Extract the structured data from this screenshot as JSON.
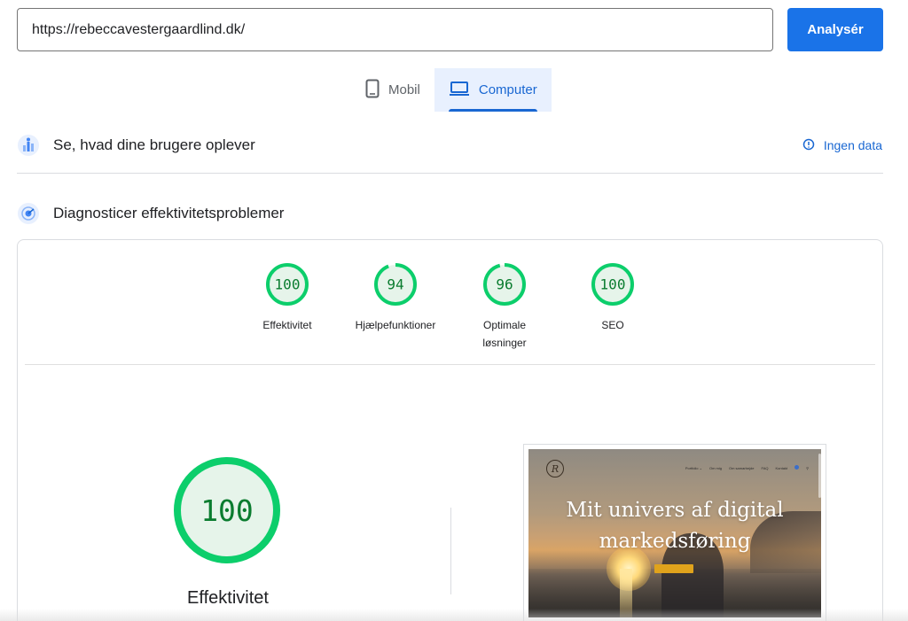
{
  "search": {
    "url_value": "https://rebeccavestergaardlind.dk/",
    "analyze_label": "Analysér"
  },
  "device_tabs": [
    {
      "label": "Mobil",
      "icon": "phone-icon",
      "active": false
    },
    {
      "label": "Computer",
      "icon": "laptop-icon",
      "active": true
    }
  ],
  "field_data": {
    "title": "Se, hvad dine brugere oplever",
    "icon": "users-chart-icon",
    "status_label": "Ingen data",
    "status_icon": "info-icon"
  },
  "lab_data": {
    "title": "Diagnosticer effektivitetsproblemer",
    "icon": "lighthouse-icon"
  },
  "scores": [
    {
      "value": 100,
      "label": "Effektivitet"
    },
    {
      "value": 94,
      "label": "Hjælpefunktioner"
    },
    {
      "value": 96,
      "label": "Optimale løsninger"
    },
    {
      "value": 100,
      "label": "SEO"
    }
  ],
  "main_score": {
    "value": 100,
    "label": "Effektivitet"
  },
  "screenshot": {
    "logo_letter": "R",
    "nav_items": [
      "Portfolio ⌄",
      "Om mig",
      "Om samarbejde",
      "FAQ",
      "Kontakt"
    ],
    "headline_line1": "Mit univers af digital",
    "headline_line2": "markedsføring"
  },
  "colors": {
    "accent": "#1a73e8",
    "pass_green": "#0cce6b",
    "pass_fill": "#e6f4ea",
    "pass_text": "#0a7c2f"
  }
}
